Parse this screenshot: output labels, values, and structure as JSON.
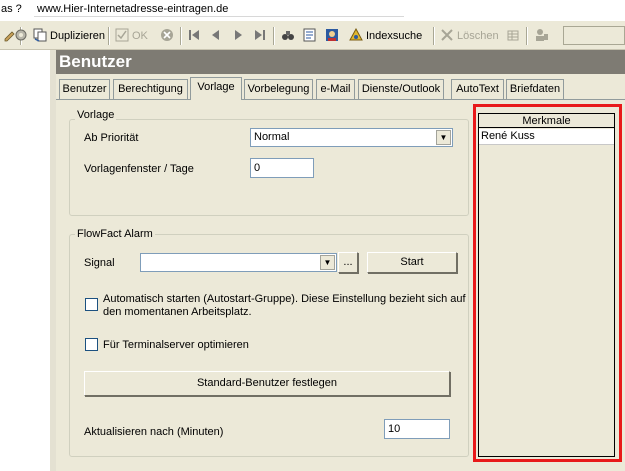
{
  "menubar": {
    "left_text": "as  ?",
    "address": "www.Hier-Internetadresse-eintragen.de"
  },
  "toolbar": {
    "duplizieren": "Duplizieren",
    "ok": "OK",
    "indexsuche": "Indexsuche",
    "loeschen": "Löschen"
  },
  "header": {
    "title": "Benutzer"
  },
  "tabs": [
    {
      "label": "Benutzer"
    },
    {
      "label": "Berechtigung"
    },
    {
      "label": "Vorlage",
      "active": true
    },
    {
      "label": "Vorbelegung"
    },
    {
      "label": "e-Mail"
    },
    {
      "label": "Dienste/Outlook"
    },
    {
      "label": "AutoText"
    },
    {
      "label": "Briefdaten"
    }
  ],
  "vorlage": {
    "title": "Vorlage",
    "prio_label": "Ab Priorität",
    "prio_value": "Normal",
    "tage_label": "Vorlagenfenster / Tage",
    "tage_value": "0"
  },
  "alarm": {
    "title": "FlowFact Alarm",
    "signal_label": "Signal",
    "signal_value": "",
    "browse_label": "...",
    "start_label": "Start",
    "auto_text_1": "Automatisch starten (Autostart-Gruppe). Diese Einstellung bezieht sich auf",
    "auto_text_2": "den momentanen Arbeitsplatz.",
    "terminal_text": "Für Terminalserver optimieren",
    "std_button": "Standard-Benutzer festlegen",
    "refresh_label": "Aktualisieren nach (Minuten)",
    "refresh_value": "10"
  },
  "merkmale": {
    "header": "Merkmale",
    "items": [
      "René Kuss"
    ]
  },
  "colors": {
    "highlight": "#e8191a",
    "header_bg": "#7e7b73",
    "panel_bg": "#ece9d8"
  }
}
